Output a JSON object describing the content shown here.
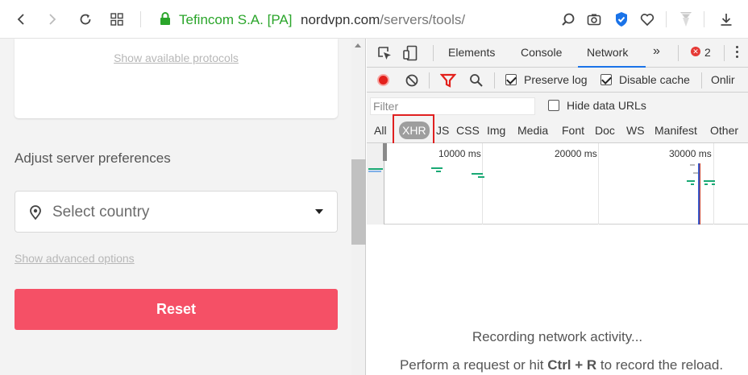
{
  "browser": {
    "org_label": "Tefincom S.A. [PA]",
    "url_host": "nordvpn.com",
    "url_path": "/servers/tools/",
    "icons": [
      "back-icon",
      "forward-icon",
      "reload-icon",
      "grid-icon",
      "lock-icon",
      "search-icon",
      "camera-icon",
      "shield-icon",
      "heart-icon",
      "extension-icon",
      "download-icon"
    ]
  },
  "page": {
    "show_protocols_link": "Show available protocols",
    "preferences_title": "Adjust server preferences",
    "country_select": "Select country",
    "show_advanced_link": "Show advanced options",
    "reset_button": "Reset",
    "accent_color": "#f55066"
  },
  "devtools": {
    "tabs": [
      "Elements",
      "Console",
      "Network"
    ],
    "active_tab": "Network",
    "more_tabs": "»",
    "error_count": "2",
    "preserve_log": {
      "label": "Preserve log",
      "checked": true
    },
    "disable_cache": {
      "label": "Disable cache",
      "checked": true
    },
    "online_label": "Onlir",
    "filter_placeholder": "Filter",
    "hide_data_urls": {
      "label": "Hide data URLs",
      "checked": false
    },
    "type_filters": [
      "All",
      "XHR",
      "JS",
      "CSS",
      "Img",
      "Media",
      "Font",
      "Doc",
      "WS",
      "Manifest",
      "Other"
    ],
    "active_type_filter": "XHR",
    "timeline_labels": [
      "10000 ms",
      "20000 ms",
      "30000 ms"
    ],
    "empty_line1": "Recording network activity...",
    "empty_line2_pre": "Perform a request or hit ",
    "empty_line2_key": "Ctrl + R",
    "empty_line2_post": " to record the reload."
  }
}
